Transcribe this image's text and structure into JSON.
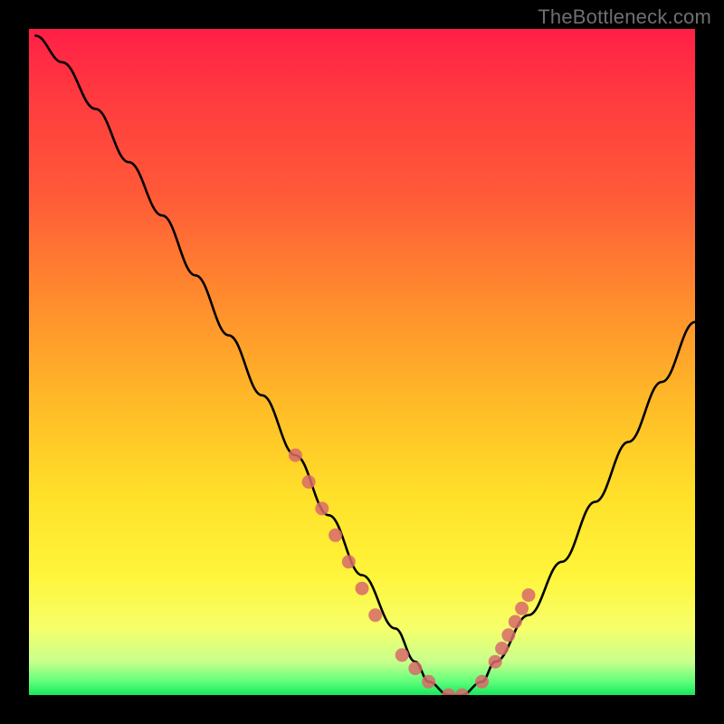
{
  "watermark": "TheBottleneck.com",
  "chart_data": {
    "type": "line",
    "title": "",
    "xlabel": "",
    "ylabel": "",
    "ylim": [
      0,
      100
    ],
    "xlim": [
      0,
      100
    ],
    "series": [
      {
        "name": "bottleneck-curve",
        "x": [
          1,
          5,
          10,
          15,
          20,
          25,
          30,
          35,
          40,
          45,
          50,
          55,
          58,
          60,
          63,
          65,
          68,
          70,
          75,
          80,
          85,
          90,
          95,
          100
        ],
        "values": [
          99,
          95,
          88,
          80,
          72,
          63,
          54,
          45,
          36,
          27,
          18,
          10,
          5,
          2,
          0,
          0,
          2,
          5,
          12,
          20,
          29,
          38,
          47,
          56
        ]
      }
    ],
    "markers": {
      "name": "highlight-dots",
      "color": "#d86a6a",
      "x": [
        40,
        42,
        44,
        46,
        48,
        50,
        52,
        56,
        58,
        60,
        63,
        65,
        68,
        70,
        71,
        72,
        73,
        74,
        75
      ],
      "values": [
        36,
        32,
        28,
        24,
        20,
        16,
        12,
        6,
        4,
        2,
        0,
        0,
        2,
        5,
        7,
        9,
        11,
        13,
        15
      ]
    }
  }
}
